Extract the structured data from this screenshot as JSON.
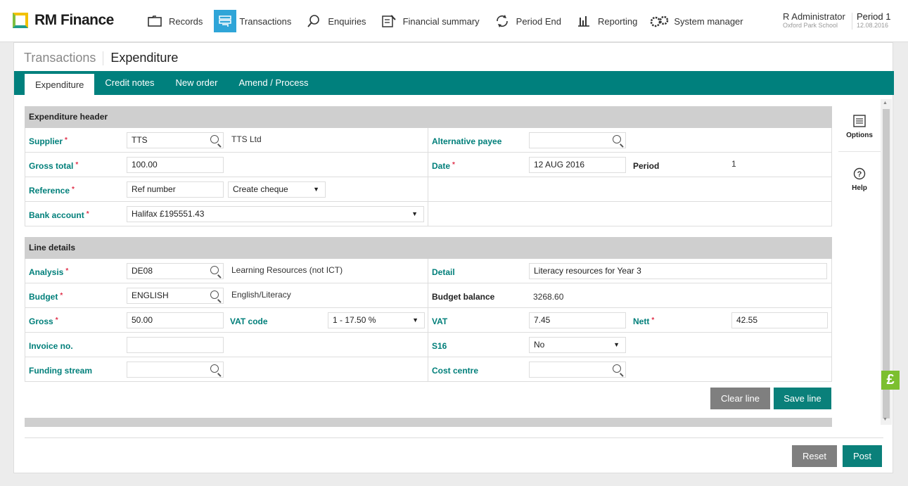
{
  "app": {
    "name": "RM Finance"
  },
  "nav": [
    {
      "label": "Records",
      "icon": "folder-icon"
    },
    {
      "label": "Transactions",
      "icon": "transactions-icon",
      "active": true
    },
    {
      "label": "Enquiries",
      "icon": "search-icon"
    },
    {
      "label": "Financial summary",
      "icon": "summary-icon"
    },
    {
      "label": "Period End",
      "icon": "cycle-icon"
    },
    {
      "label": "Reporting",
      "icon": "bar-chart-icon"
    },
    {
      "label": "System manager",
      "icon": "gears-icon"
    }
  ],
  "user": {
    "name": "R Administrator",
    "school": "Oxford Park School"
  },
  "period": {
    "label": "Period 1",
    "date": "12.08.2016"
  },
  "breadcrumb": {
    "parent": "Transactions",
    "current": "Expenditure"
  },
  "tabs": [
    {
      "label": "Expenditure",
      "active": true
    },
    {
      "label": "Credit notes"
    },
    {
      "label": "New order"
    },
    {
      "label": "Amend / Process"
    }
  ],
  "header_section": {
    "title": "Expenditure header",
    "supplier": {
      "label": "Supplier",
      "value": "TTS",
      "desc": "TTS Ltd"
    },
    "alt_payee": {
      "label": "Alternative payee",
      "value": ""
    },
    "gross_total": {
      "label": "Gross total",
      "value": "100.00"
    },
    "date": {
      "label": "Date",
      "value": "12 AUG 2016"
    },
    "period": {
      "label": "Period",
      "value": "1"
    },
    "reference": {
      "label": "Reference",
      "value": "Ref number",
      "option": "Create cheque"
    },
    "bank": {
      "label": "Bank account",
      "value": "Halifax £195551.43"
    }
  },
  "line_section": {
    "title": "Line details",
    "analysis": {
      "label": "Analysis",
      "value": "DE08",
      "desc": "Learning Resources (not ICT)"
    },
    "detail": {
      "label": "Detail",
      "value": "Literacy resources for Year 3"
    },
    "budget": {
      "label": "Budget",
      "value": "ENGLISH",
      "desc": "English/Literacy"
    },
    "budget_balance": {
      "label": "Budget balance",
      "value": "3268.60"
    },
    "gross": {
      "label": "Gross",
      "value": "50.00"
    },
    "vat_code": {
      "label": "VAT code",
      "value": "1 - 17.50 %"
    },
    "vat": {
      "label": "VAT",
      "value": "7.45"
    },
    "nett": {
      "label": "Nett",
      "value": "42.55"
    },
    "invoice": {
      "label": "Invoice no.",
      "value": ""
    },
    "s16": {
      "label": "S16",
      "value": "No"
    },
    "funding": {
      "label": "Funding stream",
      "value": ""
    },
    "cost_centre": {
      "label": "Cost centre",
      "value": ""
    }
  },
  "buttons": {
    "clear_line": "Clear line",
    "save_line": "Save line",
    "reset": "Reset",
    "post": "Post"
  },
  "side": {
    "options": "Options",
    "help": "Help"
  },
  "colors": {
    "teal": "#00807d",
    "accent_blue": "#2fa5d8",
    "required": "#e0304a"
  }
}
